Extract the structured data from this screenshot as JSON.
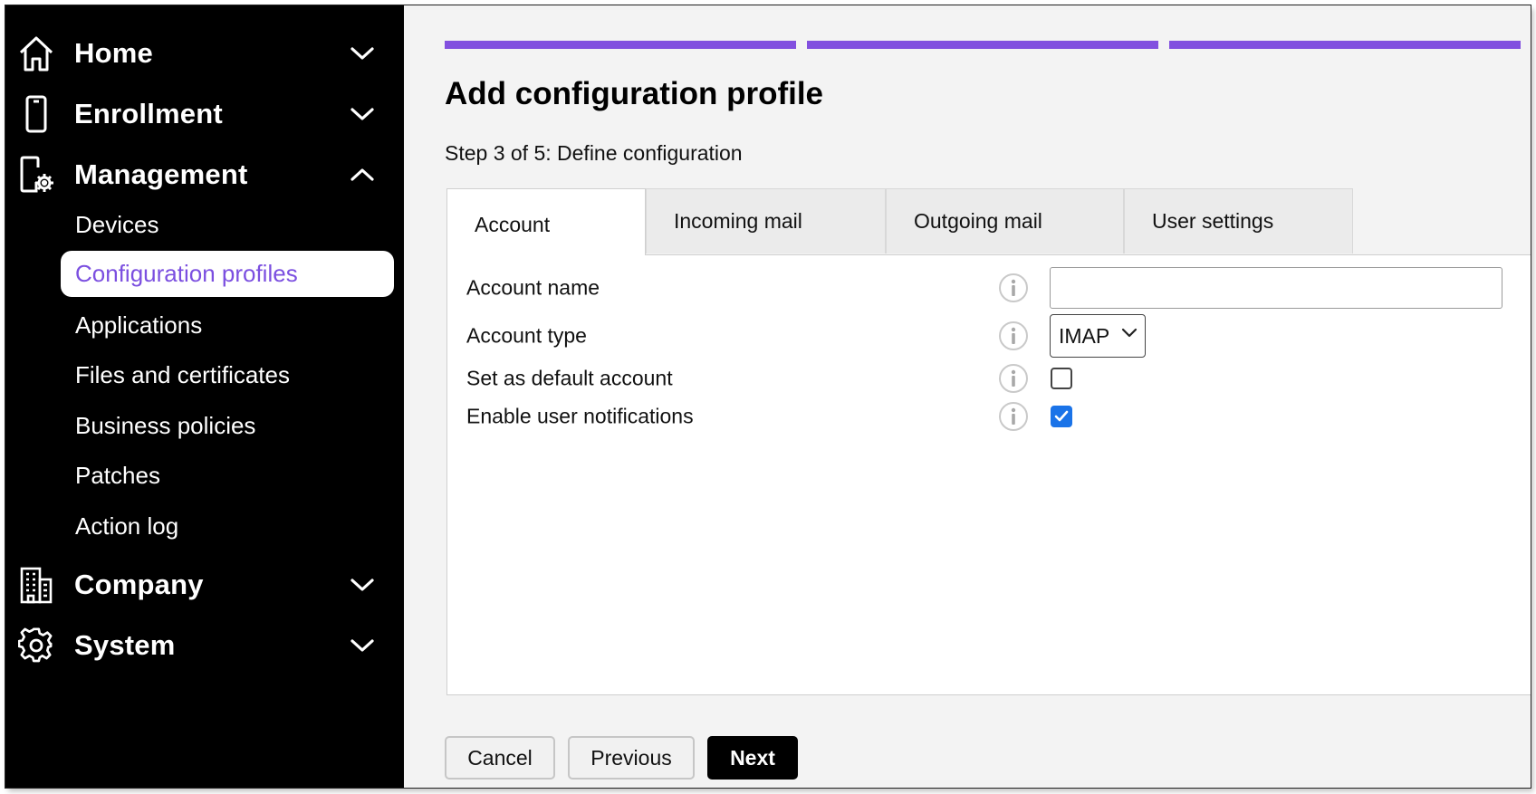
{
  "sidebar": {
    "groups": [
      {
        "label": "Home",
        "icon": "home-icon",
        "expanded": false
      },
      {
        "label": "Enrollment",
        "icon": "mobile-phone-icon",
        "expanded": false
      },
      {
        "label": "Management",
        "icon": "device-settings-icon",
        "expanded": true
      },
      {
        "label": "Company",
        "icon": "building-icon",
        "expanded": false
      },
      {
        "label": "System",
        "icon": "gear-icon",
        "expanded": false
      }
    ],
    "management_items": [
      {
        "label": "Devices",
        "active": false
      },
      {
        "label": "Configuration profiles",
        "active": true
      },
      {
        "label": "Applications",
        "active": false
      },
      {
        "label": "Files and certificates",
        "active": false
      },
      {
        "label": "Business policies",
        "active": false
      },
      {
        "label": "Patches",
        "active": false
      },
      {
        "label": "Action log",
        "active": false
      }
    ]
  },
  "wizard": {
    "progress_steps_shown": 3,
    "title": "Add configuration profile",
    "step_label": "Step 3 of 5: Define configuration"
  },
  "tabs": [
    {
      "label": "Account",
      "active": true
    },
    {
      "label": "Incoming mail",
      "active": false
    },
    {
      "label": "Outgoing mail",
      "active": false
    },
    {
      "label": "User settings",
      "active": false
    }
  ],
  "form": {
    "account_name": {
      "label": "Account name",
      "value": ""
    },
    "account_type": {
      "label": "Account type",
      "value": "IMAP"
    },
    "default_account": {
      "label": "Set as default account",
      "checked": false
    },
    "user_notifications": {
      "label": "Enable user notifications",
      "checked": true
    }
  },
  "buttons": {
    "cancel": "Cancel",
    "previous": "Previous",
    "next": "Next"
  },
  "colors": {
    "accent": "#8250df",
    "active_link": "#7b4fe0",
    "checkbox_checked": "#1a73e8",
    "sidebar_bg": "#000000"
  }
}
